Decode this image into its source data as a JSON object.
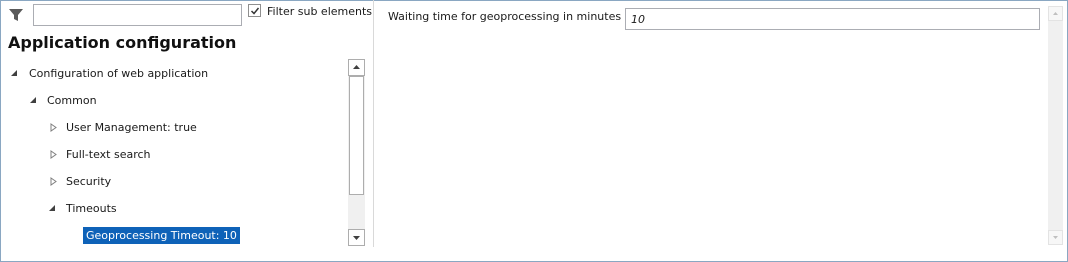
{
  "filter": {
    "input_value": "",
    "checkbox_checked": true,
    "checkbox_label": "Filter sub elements"
  },
  "title": "Application configuration",
  "tree": {
    "nodes": [
      {
        "label": "Configuration of web application",
        "level": 0,
        "state": "expanded"
      },
      {
        "label": "Common",
        "level": 1,
        "state": "expanded"
      },
      {
        "label": "User Management: true",
        "level": 2,
        "state": "collapsed"
      },
      {
        "label": "Full-text search",
        "level": 2,
        "state": "collapsed"
      },
      {
        "label": "Security",
        "level": 2,
        "state": "collapsed"
      },
      {
        "label": "Timeouts",
        "level": 2,
        "state": "expanded"
      },
      {
        "label": "Geoprocessing Timeout: 10",
        "level": 3,
        "state": "leaf",
        "selected": true
      }
    ]
  },
  "property": {
    "label": "Waiting time for geoprocessing in minutes",
    "value": "10"
  },
  "colors": {
    "selection": "#0e62b8",
    "border": "#8aa7c2"
  },
  "icons": {
    "filter": "funnel-icon",
    "expanded": "triangle-down-right-icon",
    "collapsed": "triangle-right-outline-icon"
  }
}
